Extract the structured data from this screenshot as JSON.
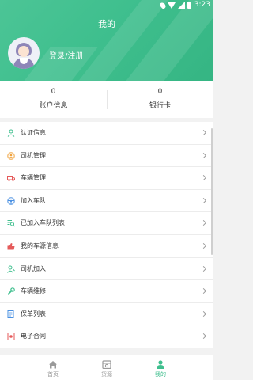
{
  "status_bar": {
    "time": "3:23"
  },
  "header": {
    "title": "我的",
    "login_label": "登录/注册"
  },
  "stats": [
    {
      "value": "0",
      "label": "账户信息"
    },
    {
      "value": "0",
      "label": "银行卡"
    }
  ],
  "menu": {
    "items": [
      {
        "label": "认证信息",
        "icon": "user-icon",
        "color": "#3fbf8e"
      },
      {
        "label": "司机管理",
        "icon": "driver-icon",
        "color": "#f0a23c"
      },
      {
        "label": "车辆管理",
        "icon": "truck-icon",
        "color": "#e55a5a"
      },
      {
        "label": "加入车队",
        "icon": "steering-wheel-icon",
        "color": "#4a90e2"
      },
      {
        "label": "已加入车队列表",
        "icon": "list-search-icon",
        "color": "#3fbf8e"
      },
      {
        "label": "我的车源信息",
        "icon": "thumb-icon",
        "color": "#e55a5a"
      },
      {
        "label": "司机加入",
        "icon": "user-add-icon",
        "color": "#3fbf8e"
      },
      {
        "label": "车辆维修",
        "icon": "wrench-icon",
        "color": "#3fbf8e"
      },
      {
        "label": "保单列表",
        "icon": "document-icon",
        "color": "#4a90e2"
      },
      {
        "label": "电子合同",
        "icon": "contract-icon",
        "color": "#e55a5a"
      }
    ]
  },
  "tabbar": {
    "tabs": [
      {
        "label": "首页",
        "icon": "home-icon",
        "active": false
      },
      {
        "label": "货源",
        "icon": "cargo-icon",
        "active": false
      },
      {
        "label": "我的",
        "icon": "profile-icon",
        "active": true
      }
    ]
  },
  "colors": {
    "brand": "#3fbf8e",
    "inactive": "#999999"
  }
}
